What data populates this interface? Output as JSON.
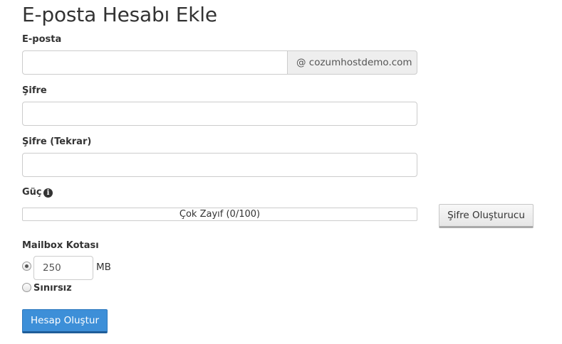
{
  "page": {
    "title": "E-posta Hesabı Ekle"
  },
  "form": {
    "email": {
      "label": "E-posta",
      "value": "",
      "placeholder": "",
      "domain_addon": "@ cozumhostdemo.com"
    },
    "password": {
      "label": "Şifre",
      "value": ""
    },
    "password_repeat": {
      "label": "Şifre (Tekrar)",
      "value": ""
    },
    "strength": {
      "label": "Güç",
      "text": "Çok Zayıf (0/100)",
      "score": 0,
      "max": 100
    },
    "generator_button": "Şifre Oluşturucu",
    "quota": {
      "label": "Mailbox Kotası",
      "value": "250",
      "unit": "MB",
      "selected": "limited",
      "unlimited_label": "Sınırsız"
    },
    "submit_button": "Hesap Oluştur"
  },
  "colors": {
    "primary": "#3d8fd8",
    "addon_bg": "#eeeeee",
    "strength_bad": "#d9534f"
  },
  "icons": {
    "strength_info": "info-circle-icon"
  }
}
